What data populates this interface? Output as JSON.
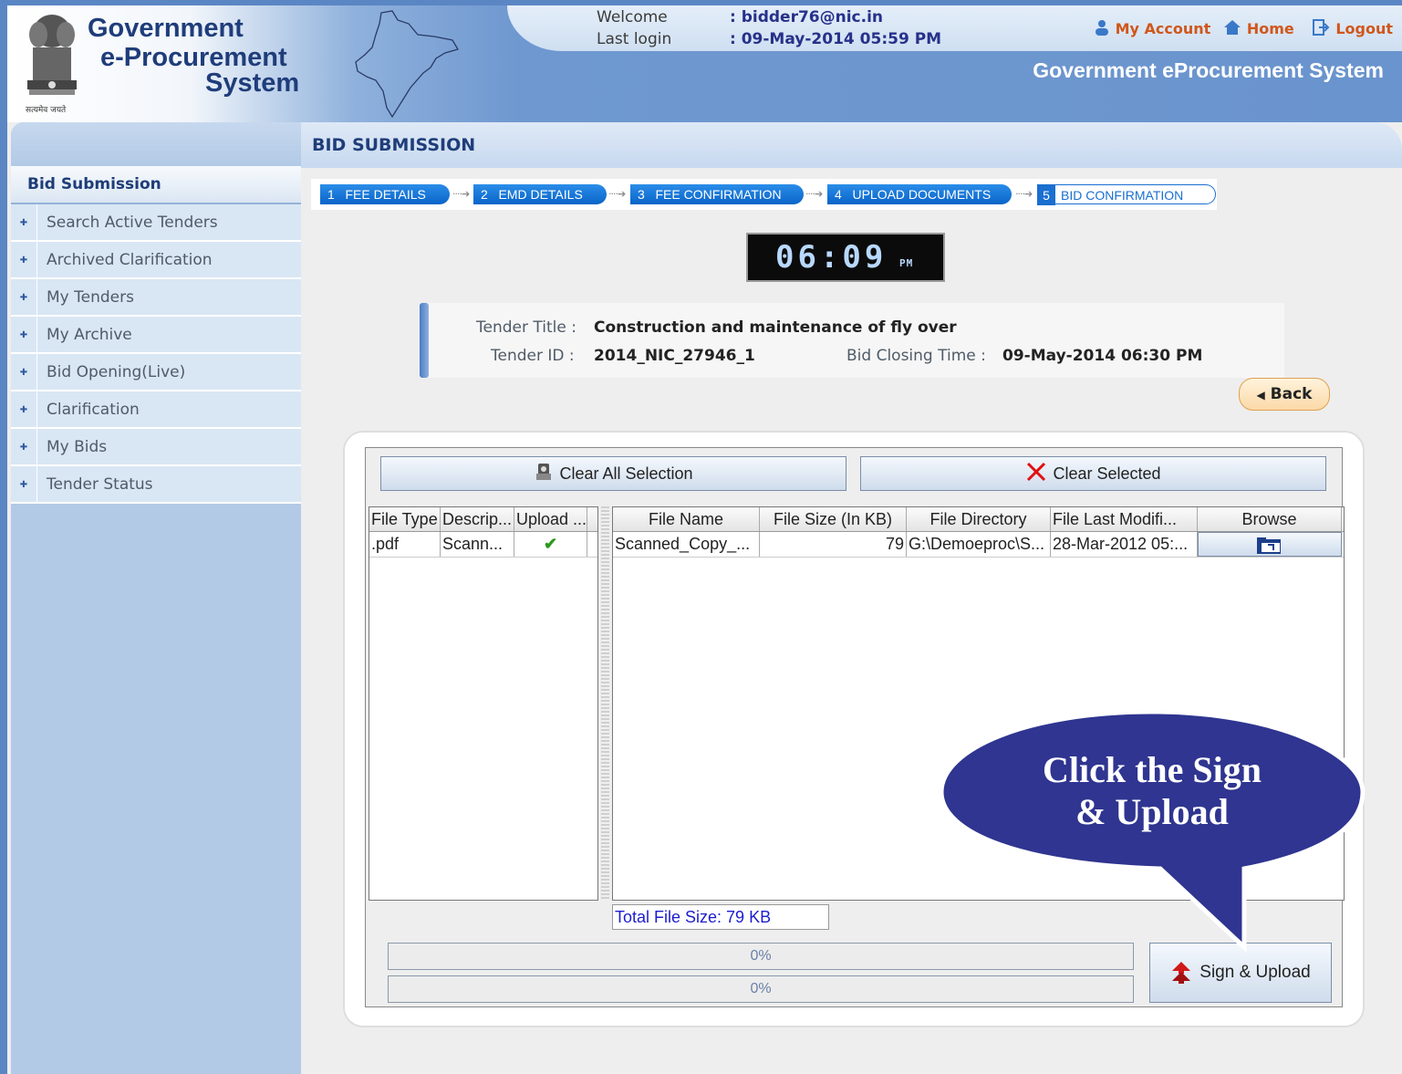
{
  "header": {
    "brand_line1": "Government",
    "brand_line2": "e-Procurement",
    "brand_line3": "System",
    "emblem_caption": "सत्यमेव जयते",
    "welcome_label": "Welcome",
    "welcome_value": ":  bidder76@nic.in",
    "lastlogin_label": "Last login",
    "lastlogin_value": ":  09-May-2014 05:59 PM",
    "links": {
      "account": "My Account",
      "home": "Home",
      "logout": "Logout"
    },
    "system_name": "Government eProcurement System"
  },
  "sidebar": {
    "title": "Bid Submission",
    "items": [
      {
        "label": "Search Active Tenders"
      },
      {
        "label": "Archived Clarification"
      },
      {
        "label": "My Tenders"
      },
      {
        "label": "My Archive"
      },
      {
        "label": "Bid Opening(Live)"
      },
      {
        "label": "Clarification"
      },
      {
        "label": "My Bids"
      },
      {
        "label": "Tender Status"
      }
    ]
  },
  "main": {
    "title": "BID SUBMISSION",
    "steps": [
      {
        "num": "1",
        "label": "FEE DETAILS"
      },
      {
        "num": "2",
        "label": "EMD DETAILS"
      },
      {
        "num": "3",
        "label": "FEE CONFIRMATION"
      },
      {
        "num": "4",
        "label": "UPLOAD DOCUMENTS"
      },
      {
        "num": "5",
        "label": "BID CONFIRMATION"
      }
    ],
    "clock": {
      "time": "06:09",
      "ampm": "PM"
    },
    "tender": {
      "title_label": "Tender Title :",
      "title_value": "Construction and maintenance of fly over",
      "id_label": "Tender ID :",
      "id_value": "2014_NIC_27946_1",
      "closing_label": "Bid Closing Time :",
      "closing_value": "09-May-2014 06:30 PM"
    },
    "back_label": "Back"
  },
  "applet": {
    "clear_all_label": "Clear All Selection",
    "clear_selected_label": "Clear Selected",
    "left_table": {
      "headers": [
        "File Type",
        "Descrip...",
        "Upload ..."
      ],
      "rows": [
        {
          "type": ".pdf",
          "desc": "Scann...",
          "upload": "✔"
        }
      ]
    },
    "right_table": {
      "headers": [
        "File Name",
        "File Size (In KB)",
        "File Directory",
        "File Last Modifi...",
        "Browse"
      ],
      "rows": [
        {
          "name": "Scanned_Copy_...",
          "size": "79",
          "dir": "G:\\Demoeproc\\S...",
          "modified": "28-Mar-2012 05:..."
        }
      ]
    },
    "total_size": "Total File Size: 79 KB",
    "progress1": "0%",
    "progress2": "0%",
    "sign_upload_label": "Sign & Upload"
  },
  "callout": {
    "line1": "Click the Sign",
    "line2": "& Upload"
  },
  "colors": {
    "brand": "#1f3d7a",
    "step_blue": "#0a64c8",
    "link_orange": "#d0571b",
    "callout_fill": "#2f3590",
    "total_size_text": "#1c1cd0"
  }
}
